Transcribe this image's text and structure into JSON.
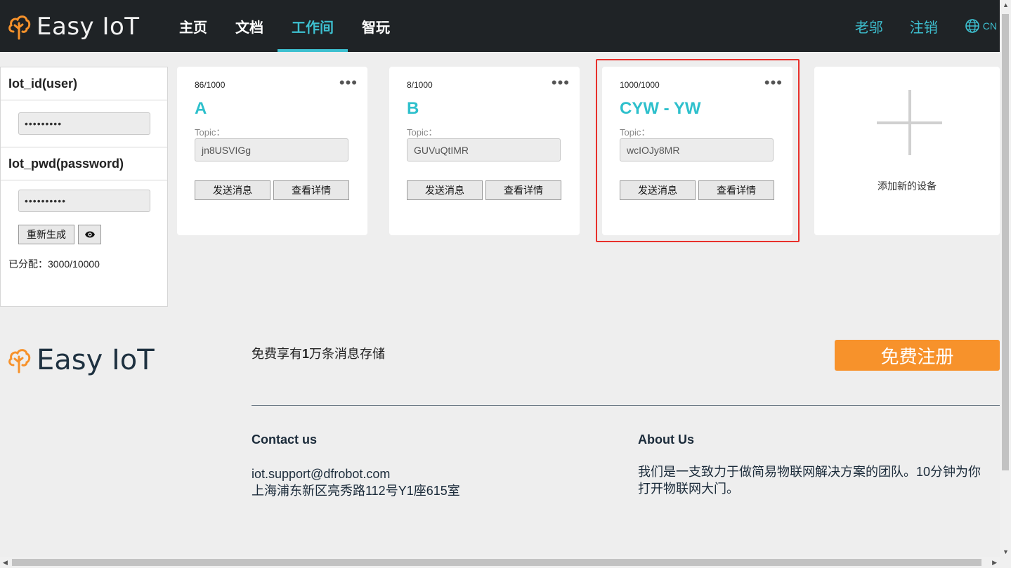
{
  "header": {
    "logo_text": "Easy IoT",
    "nav": [
      {
        "label": "主页"
      },
      {
        "label": "文档"
      },
      {
        "label": "工作间",
        "active": true
      },
      {
        "label": "智玩"
      }
    ],
    "user": "老邬",
    "logout": "注销",
    "lang": "CN"
  },
  "credentials": {
    "id_label": "Iot_id(user)",
    "id_value": "•••••••••",
    "pwd_label": "Iot_pwd(password)",
    "pwd_value": "••••••••••",
    "regen_button": "重新生成",
    "quota_label": "已分配：",
    "quota_value": "3000/10000"
  },
  "devices": [
    {
      "count": "86/1000",
      "name": "A",
      "topic_label": "Topic：",
      "topic": "jn8USVIGg",
      "send": "发送消息",
      "detail": "查看详情"
    },
    {
      "count": "8/1000",
      "name": "B",
      "topic_label": "Topic：",
      "topic": "GUVuQtIMR",
      "send": "发送消息",
      "detail": "查看详情"
    },
    {
      "count": "1000/1000",
      "name": "CYW - YW",
      "topic_label": "Topic：",
      "topic": "wcIOJy8MR",
      "send": "发送消息",
      "detail": "查看详情"
    }
  ],
  "add_device": {
    "label": "添加新的设备"
  },
  "footer": {
    "logo_text": "Easy IoT",
    "promo_prefix": "免费享有",
    "promo_bold": "1",
    "promo_suffix": "万条消息存储",
    "register": "免费注册",
    "contact_title": "Contact us",
    "contact_email": "iot.support@dfrobot.com",
    "contact_address": "上海浦东新区亮秀路112号Y1座615室",
    "about_title": "About Us",
    "about_text": "我们是一支致力于做简易物联网解决方案的团队。10分钟为你打开物联网大门。"
  },
  "colors": {
    "header_bg": "#1f2326",
    "accent": "#3dc0d0",
    "register_orange": "#f7922b",
    "highlight_red": "#e8302b"
  }
}
